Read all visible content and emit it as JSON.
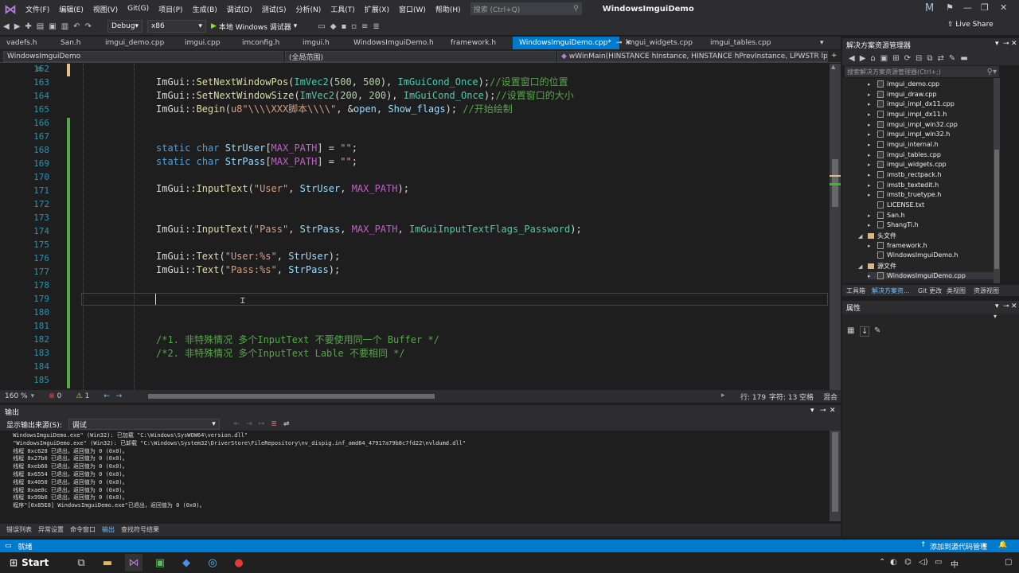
{
  "menu": {
    "items": [
      "文件(F)",
      "编辑(E)",
      "视图(V)",
      "Git(G)",
      "项目(P)",
      "生成(B)",
      "调试(D)",
      "测试(S)",
      "分析(N)",
      "工具(T)",
      "扩展(X)",
      "窗口(W)",
      "帮助(H)"
    ],
    "search_placeholder": "搜索 (Ctrl+Q)",
    "app_title": "WindowsImguiDemo",
    "account_initial": "M"
  },
  "toolbar": {
    "config": "Debug",
    "platform": "x86",
    "run_label": "本地 Windows 调试器",
    "live_share": "Live Share"
  },
  "tabs": [
    {
      "label": "vadefs.h",
      "active": false
    },
    {
      "label": "San.h",
      "active": false
    },
    {
      "label": "imgui_demo.cpp",
      "active": false
    },
    {
      "label": "imgui.cpp",
      "active": false
    },
    {
      "label": "imconfig.h",
      "active": false
    },
    {
      "label": "imgui.h",
      "active": false
    },
    {
      "label": "WindowsImguiDemo.h",
      "active": false
    },
    {
      "label": "framework.h",
      "active": false
    },
    {
      "label": "WindowsImguiDemo.cpp*",
      "active": true
    },
    {
      "label": "imgui_widgets.cpp",
      "active": false
    },
    {
      "label": "imgui_tables.cpp",
      "active": false
    }
  ],
  "navbar": {
    "project": "WindowsImguiDemo",
    "scope": "(全局范围)",
    "function": "wWinMain(HINSTANCE hInstance, HINSTANCE hPrevInstance, LPWSTR lpCmdLine,"
  },
  "editor": {
    "line_numbers": [
      "162",
      "163",
      "164",
      "165",
      "166",
      "167",
      "168",
      "169",
      "170",
      "171",
      "172",
      "173",
      "174",
      "175",
      "176",
      "177",
      "178",
      "179",
      "180",
      "181",
      "182",
      "183",
      "184",
      "185"
    ],
    "zoom": "160 %",
    "errors": "0",
    "warnings": "1",
    "line": "行: 179",
    "col": "字符: 13",
    "tab_mode": "空格",
    "eol": "混合"
  },
  "code": {
    "l163_a": "ImGui::",
    "l163_b": "SetNextWindowPos",
    "l163_c": "(",
    "l163_d": "ImVec2",
    "l163_e": "(",
    "l163_f": "500",
    "l163_g": ", ",
    "l163_h": "500",
    "l163_i": "), ",
    "l163_j": "ImGuiCond_Once",
    "l163_k": ");",
    "l163_l": "//设置窗口的位置",
    "l164_a": "ImGui::",
    "l164_b": "SetNextWindowSize",
    "l164_c": "(",
    "l164_d": "ImVec2",
    "l164_e": "(",
    "l164_f": "200",
    "l164_g": ", ",
    "l164_h": "200",
    "l164_i": "), ",
    "l164_j": "ImGuiCond_Once",
    "l164_k": ");",
    "l164_l": "//设置窗口的大小",
    "l165_a": "ImGui::",
    "l165_b": "Begin",
    "l165_c": "(",
    "l165_d": "u8\"\\\\\\\\XXX脚本\\\\\\\\\"",
    "l165_e": ", &",
    "l165_f": "open",
    "l165_g": ", ",
    "l165_h": "Show_flags",
    "l165_i": "); ",
    "l165_j": "//开始绘制",
    "l168_a": "static",
    "l168_b": " ",
    "l168_c": "char",
    "l168_d": " ",
    "l168_e": "StrUser",
    "l168_f": "[",
    "l168_g": "MAX_PATH",
    "l168_h": "] = ",
    "l168_i": "\"\"",
    "l168_j": ";",
    "l169_a": "static",
    "l169_b": " ",
    "l169_c": "char",
    "l169_d": " ",
    "l169_e": "StrPass",
    "l169_f": "[",
    "l169_g": "MAX_PATH",
    "l169_h": "] = ",
    "l169_i": "\"\"",
    "l169_j": ";",
    "l171_a": "ImGui::",
    "l171_b": "InputText",
    "l171_c": "(",
    "l171_d": "\"User\"",
    "l171_e": ", ",
    "l171_f": "StrUser",
    "l171_g": ", ",
    "l171_h": "MAX_PATH",
    "l171_i": ");",
    "l174_a": "ImGui::",
    "l174_b": "InputText",
    "l174_c": "(",
    "l174_d": "\"Pass\"",
    "l174_e": ", ",
    "l174_f": "StrPass",
    "l174_g": ", ",
    "l174_h": "MAX_PATH",
    "l174_i": ", ",
    "l174_j": "ImGuiInputTextFlags_Password",
    "l174_k": ");",
    "l176_a": "ImGui::",
    "l176_b": "Text",
    "l176_c": "(",
    "l176_d": "\"User:%s\"",
    "l176_e": ", ",
    "l176_f": "StrUser",
    "l176_g": ");",
    "l177_a": "ImGui::",
    "l177_b": "Text",
    "l177_c": "(",
    "l177_d": "\"Pass:%s\"",
    "l177_e": ", ",
    "l177_f": "StrPass",
    "l177_g": ");",
    "l182": "/*1. 非特殊情况 多个InputText 不要使用同一个 Buffer */",
    "l183": "/*2. 非特殊情况 多个InputText Lable 不要相同 */"
  },
  "solution": {
    "title": "解决方案资源管理器",
    "search_placeholder": "搜索解决方案资源管理器(Ctrl+;)",
    "items": [
      {
        "label": "imgui_demo.cpp",
        "arrow": "▸",
        "kind": "cpp"
      },
      {
        "label": "imgui_draw.cpp",
        "arrow": "▸",
        "kind": "cpp"
      },
      {
        "label": "imgui_impl_dx11.cpp",
        "arrow": "▸",
        "kind": "cpp"
      },
      {
        "label": "imgui_impl_dx11.h",
        "arrow": "▸",
        "kind": "h"
      },
      {
        "label": "imgui_impl_win32.cpp",
        "arrow": "▸",
        "kind": "cpp"
      },
      {
        "label": "imgui_impl_win32.h",
        "arrow": "▸",
        "kind": "h"
      },
      {
        "label": "imgui_internal.h",
        "arrow": "▸",
        "kind": "h"
      },
      {
        "label": "imgui_tables.cpp",
        "arrow": "▸",
        "kind": "cpp"
      },
      {
        "label": "imgui_widgets.cpp",
        "arrow": "▸",
        "kind": "cpp"
      },
      {
        "label": "imstb_rectpack.h",
        "arrow": "▸",
        "kind": "h"
      },
      {
        "label": "imstb_textedit.h",
        "arrow": "▸",
        "kind": "h"
      },
      {
        "label": "imstb_truetype.h",
        "arrow": "▸",
        "kind": "h"
      },
      {
        "label": "LICENSE.txt",
        "arrow": "",
        "kind": "h"
      },
      {
        "label": "San.h",
        "arrow": "▸",
        "kind": "h"
      },
      {
        "label": "ShangTi.h",
        "arrow": "▸",
        "kind": "h"
      },
      {
        "label": "头文件",
        "arrow": "◢",
        "kind": "folder"
      },
      {
        "label": "framework.h",
        "arrow": "▸",
        "kind": "h"
      },
      {
        "label": "WindowsImguiDemo.h",
        "arrow": "",
        "kind": "h"
      },
      {
        "label": "源文件",
        "arrow": "◢",
        "kind": "folder"
      },
      {
        "label": "WindowsImguiDemo.cpp",
        "arrow": "▸",
        "kind": "cpp"
      }
    ],
    "bottom_tabs": [
      "工具箱",
      "解决方案资...",
      "Git 更改",
      "类视图",
      "资源视图"
    ]
  },
  "properties": {
    "title": "属性"
  },
  "output": {
    "title": "输出",
    "source_label": "显示输出来源(S):",
    "source_value": "调试",
    "lines": [
      " WindowsImguiDemo.exe\" (Win32): 已加载 \"C:\\Windows\\SysWOW64\\version.dll\"",
      " \"WindowsImguiDemo.exe\" (Win32): 已卸载 \"C:\\Windows\\System32\\DriverStore\\FileRepository\\nv_dispig.inf_amd64_47917a79b8c7fd22\\nvldumd.dll\"",
      " 线程 0xc628 已退出，返回值为 0 (0x0)。",
      " 线程 0x27b0 已退出，返回值为 0 (0x0)。",
      " 线程 0xeb60 已退出，返回值为 0 (0x0)。",
      " 线程 0x6554 已退出，返回值为 0 (0x0)。",
      " 线程 0x4050 已退出，返回值为 0 (0x0)。",
      " 线程 0xae0c 已退出，返回值为 0 (0x0)。",
      " 线程 0x99b0 已退出，返回值为 0 (0x0)。",
      " 程序\"[0x85E8] WindowsImguiDemo.exe\"已退出，返回值为 0 (0x0)。"
    ],
    "bottom_tabs": [
      "错误列表",
      "异常设置",
      "命令窗口",
      "输出",
      "查找符号结果"
    ]
  },
  "statusbar": {
    "ready": "就绪",
    "source_control": "添加到源代码管理"
  },
  "taskbar": {
    "start": "Start",
    "ime": "中"
  },
  "colors": {
    "accent": "#007acc",
    "background": "#1e1e1e"
  }
}
